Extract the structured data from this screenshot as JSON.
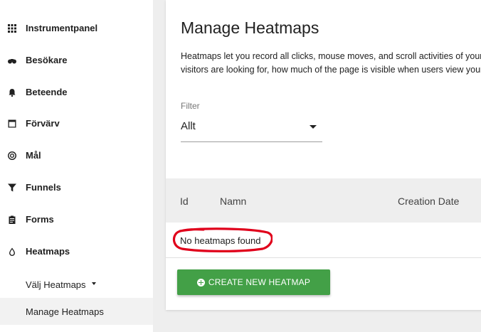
{
  "sidebar": {
    "items": [
      {
        "label": "Instrumentpanel",
        "icon": "dashboard-grid-icon"
      },
      {
        "label": "Besökare",
        "icon": "binoculars-icon"
      },
      {
        "label": "Beteende",
        "icon": "bell-icon"
      },
      {
        "label": "Förvärv",
        "icon": "window-icon"
      },
      {
        "label": "Mål",
        "icon": "target-icon"
      },
      {
        "label": "Funnels",
        "icon": "funnel-icon"
      },
      {
        "label": "Forms",
        "icon": "clipboard-icon"
      },
      {
        "label": "Heatmaps",
        "icon": "drop-icon"
      }
    ],
    "sub_items": [
      {
        "label": "Välj Heatmaps"
      },
      {
        "label": "Manage Heatmaps",
        "active": true
      }
    ]
  },
  "main": {
    "title": "Manage Heatmaps",
    "description_line1": "Heatmaps let you record all clicks, mouse moves, and scroll activities of your",
    "description_line2": "visitors are looking for, how much of the page is visible when users view your",
    "filter": {
      "label": "Filter",
      "value": "Allt"
    },
    "table": {
      "columns": [
        "Id",
        "Namn",
        "Creation Date"
      ],
      "empty_message": "No heatmaps found"
    },
    "create_button_label": "CREATE NEW HEATMAP"
  },
  "colors": {
    "accent_green": "#43a047",
    "annotation_red": "#e0001b"
  }
}
